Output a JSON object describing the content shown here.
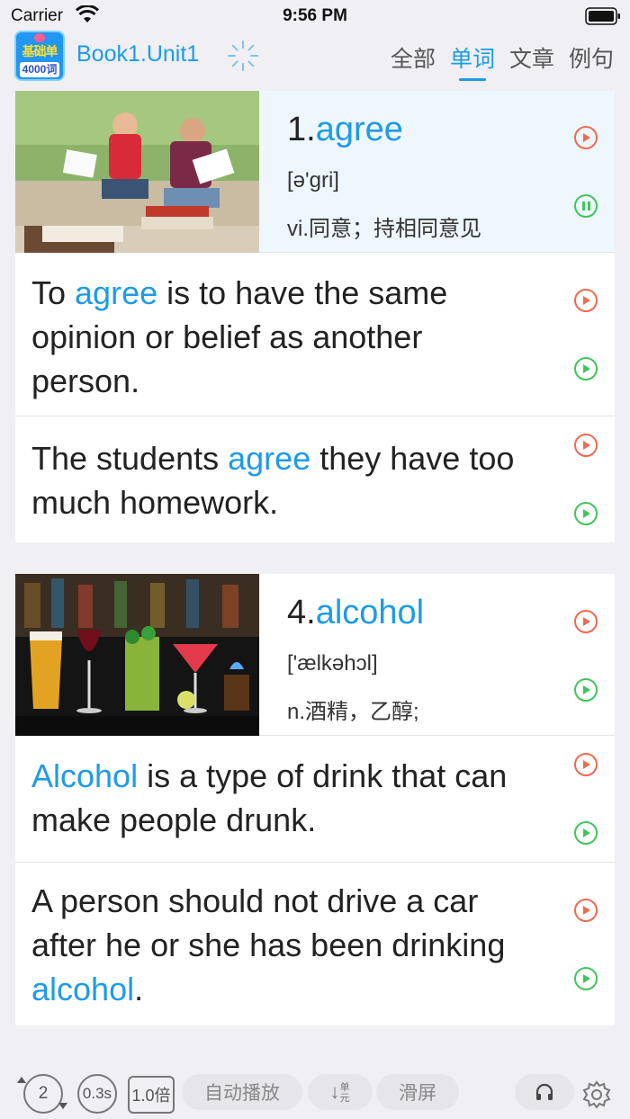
{
  "status": {
    "carrier": "Carrier",
    "time": "9:56 PM"
  },
  "nav": {
    "logo_top": "基础单词",
    "logo_bottom": "4000词",
    "title": "Book1.Unit1",
    "tabs": [
      {
        "label": "全部",
        "active": false
      },
      {
        "label": "单词",
        "active": true
      },
      {
        "label": "文章",
        "active": false
      },
      {
        "label": "例句",
        "active": false
      }
    ]
  },
  "entries": [
    {
      "number": "1.",
      "word": "agree",
      "phonetic": "[ə'gri]",
      "meaning": "vi.同意；持相同意见",
      "sentences": [
        {
          "before": "To ",
          "hl": "agree",
          "after": " is to have the same opinion or belief as another person."
        },
        {
          "before": "The students ",
          "hl": "agree",
          "after": " they have too much homework."
        }
      ]
    },
    {
      "number": "4.",
      "word": "alcohol",
      "phonetic": "['ælkəhɔl]",
      "meaning": "n.酒精，乙醇;",
      "sentences": [
        {
          "before": "",
          "hl": "Alcohol",
          "after": " is a type of drink that can make people drunk."
        },
        {
          "before": "A person should not drive a car after he or she has been drinking ",
          "hl": "alcohol",
          "after": "."
        }
      ]
    }
  ],
  "toolbar": {
    "repeat": "2",
    "interval": "0.3s",
    "speed": "1.0倍",
    "autoplay": "自动播放",
    "unit_arrow": "↓",
    "unit_small": "单元",
    "scroll": "滑屏"
  },
  "colors": {
    "accent": "#1e9be6",
    "play_red": "#f06a4e",
    "play_green": "#3fc65a",
    "background": "#efeff4"
  },
  "icons": [
    "wifi-icon",
    "battery-icon",
    "spinner-icon",
    "play-icon",
    "pause-icon",
    "repeat-icon",
    "headphones-icon",
    "gear-icon"
  ]
}
